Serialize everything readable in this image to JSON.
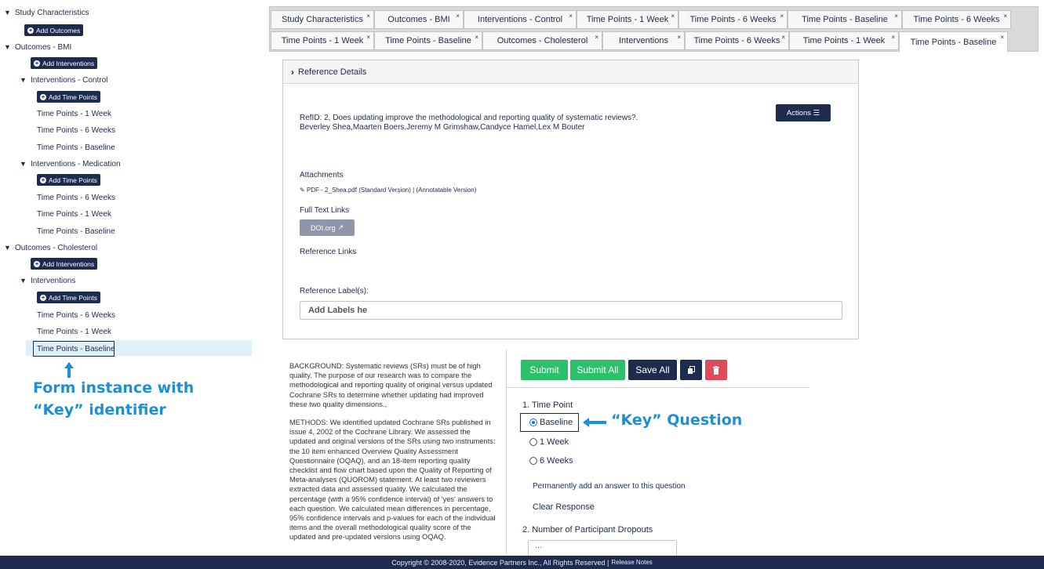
{
  "tree": {
    "items": [
      {
        "kind": "node",
        "label": "Study Characteristics"
      },
      {
        "kind": "button",
        "label": "Add Outcomes"
      },
      {
        "kind": "node",
        "label": "Outcomes - BMI"
      },
      {
        "kind": "button",
        "label": "Add Interventions"
      },
      {
        "kind": "node",
        "label": "Interventions - Control"
      },
      {
        "kind": "button",
        "label": "Add Time Points"
      },
      {
        "kind": "leaf",
        "label": "Time Points - 1 Week"
      },
      {
        "kind": "leaf",
        "label": "Time Points - 6 Weeks"
      },
      {
        "kind": "leaf",
        "label": "Time Points - Baseline"
      },
      {
        "kind": "node",
        "label": "Interventions - Medication"
      },
      {
        "kind": "button",
        "label": "Add Time Points"
      },
      {
        "kind": "leaf",
        "label": "Time Points - 6 Weeks"
      },
      {
        "kind": "leaf",
        "label": "Time Points - 1 Week"
      },
      {
        "kind": "leaf",
        "label": "Time Points - Baseline"
      },
      {
        "kind": "node",
        "label": "Outcomes - Cholesterol"
      },
      {
        "kind": "button",
        "label": "Add Interventions"
      },
      {
        "kind": "node",
        "label": "Interventions"
      },
      {
        "kind": "button",
        "label": "Add Time Points"
      },
      {
        "kind": "leaf",
        "label": "Time Points - 6 Weeks"
      },
      {
        "kind": "leaf",
        "label": "Time Points - 1 Week"
      },
      {
        "kind": "leaf",
        "label": "Time Points - Baseline",
        "selected": true
      }
    ],
    "annotation_line1": "Form instance with",
    "annotation_line2": "“Key” identifier"
  },
  "tabs": {
    "row1": [
      "Study Characteristics",
      "Outcomes - BMI",
      "Interventions - Control",
      "Time Points - 1 Week",
      "Time Points - 6 Weeks",
      "Time Points - Baseline",
      "Time Points - 6 Weeks"
    ],
    "row2": [
      "Time Points - 1 Week",
      "Time Points - Baseline",
      "Outcomes - Cholesterol",
      "Interventions",
      "Time Points - 6 Weeks",
      "Time Points - 1 Week",
      "Time Points - Baseline"
    ],
    "close_glyph": "×",
    "active": "Time Points - Baseline"
  },
  "reference": {
    "header": "Reference Details",
    "citation": "RefID: 2, Does updating improve the methodological and reporting quality of systematic reviews?.",
    "authors": "Beverley Shea,Maarten Boers,Jeremy M Grimshaw,Candyce Hamel,Lex M Bouter",
    "actions_label": "Actions ☰",
    "attachments_label": "Attachments",
    "attachment_text": "PDF - 2_Shea.pdf  (Standard Version)  |  (Annotatable Version)",
    "full_text_label": "Full Text Links",
    "doi_label": "DOI.org",
    "ref_links_label": "Reference Links",
    "ref_labels_label": "Reference Label(s):",
    "labels_placeholder": "Add Labels he"
  },
  "abstract": {
    "background": "BACKGROUND: Systematic reviews (SRs) must be of high quality. The purpose of our research was to compare the methodological and reporting quality of original versus updated Cochrane SRs to determine whether updating had improved these two quality dimensions.,",
    "methods": "METHODS: We identified updated Cochrane SRs published in issue 4, 2002 of the Cochrane Library. We assessed the updated and original versions of the SRs using two instruments: the 10 item enhanced Overview Quality Assessment Questionnaire (OQAQ), and an 18-item reporting quality checklist and flow chart based upon the Quality of Reporting of Meta-analyses (QUOROM) statement. At least two reviewers extracted data and assessed quality. We calculated the percentage (with a 95% confidence interval) of 'yes' answers to each question. We calculated mean differences in percentage, 95% confidence intervals and p-values for each of the individual items and the overall methodological quality score of the updated and pre-updated versions using OQAQ."
  },
  "form": {
    "submit": "Submit",
    "submit_all": "Submit All",
    "save_all": "Save All",
    "q1_label": "1. Time Point",
    "options": [
      "Baseline",
      "1 Week",
      "6 Weeks"
    ],
    "selected": "Baseline",
    "key_annotation": "“Key” Question",
    "perm_add": "Permanently add an answer to this question",
    "clear": "Clear Response",
    "q2_label": "2. Number of Participant Dropouts",
    "q2_value": "..."
  },
  "footer": {
    "copyright": "Copyright © 2008-2020, Evidence Partners Inc., All Rights Reserved |",
    "release_notes": "Release Notes"
  },
  "colors": {
    "navy": "#1d2b4f",
    "green": "#2ebf6a",
    "red": "#e04b5a",
    "annotation_blue": "#1d8fd6",
    "selection": "#dff1f8"
  }
}
